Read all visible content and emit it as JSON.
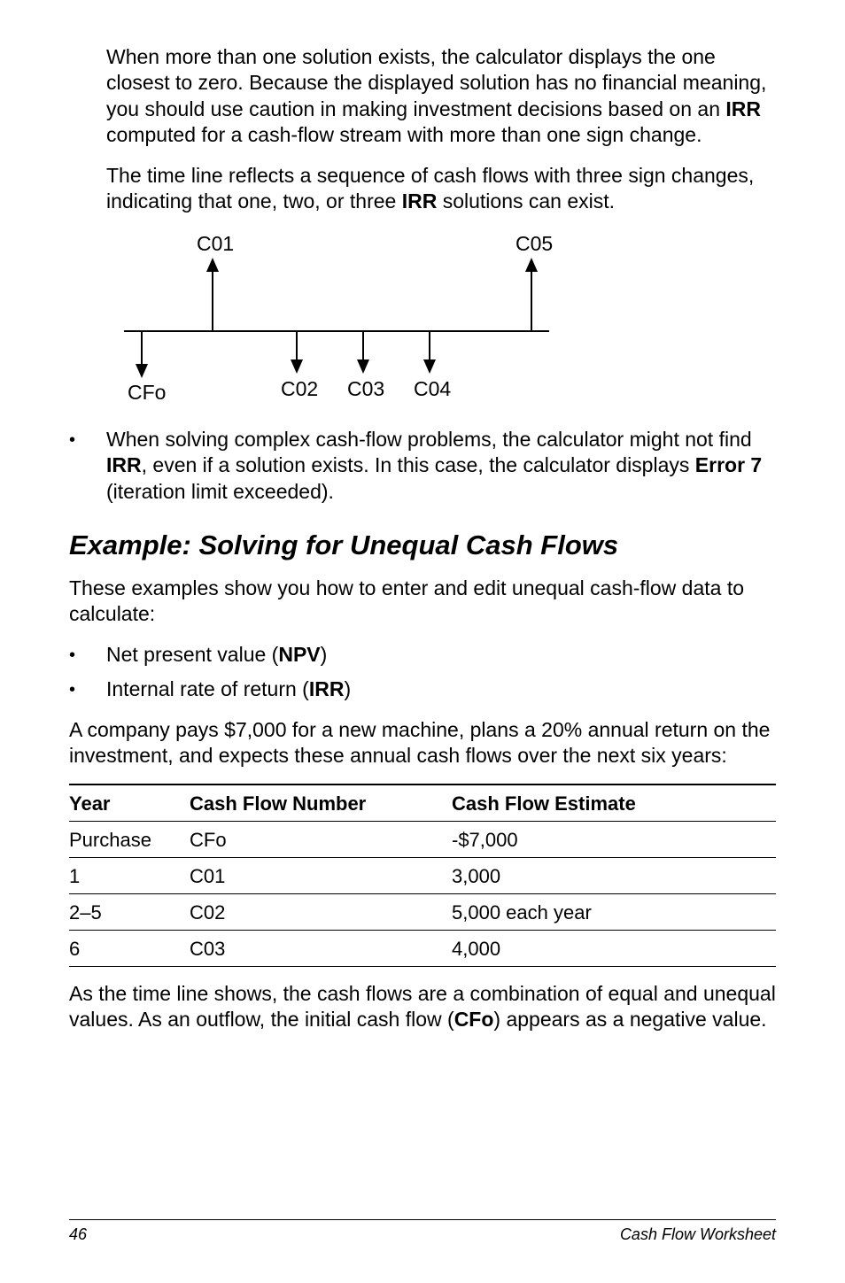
{
  "para1": {
    "pre": "When more than one solution exists, the calculator displays the one closest to zero. Because the displayed solution has no financial meaning, you should use caution in making investment decisions based on an ",
    "irr": "IRR",
    "post": " computed for a cash-flow stream with more than one sign change."
  },
  "para2": {
    "pre": "The time line reflects a sequence of cash flows with three sign changes, indicating that one, two, or three ",
    "irr": "IRR",
    "post": " solutions can exist."
  },
  "diagram": {
    "cfo": "CFo",
    "c01": "C01",
    "c02": "C02",
    "c03": "C03",
    "c04": "C04",
    "c05": "C05"
  },
  "bullet_complex": {
    "pre": "When solving complex cash-flow problems, the calculator might not find ",
    "irr": "IRR",
    "mid": ", even if a solution exists. In this case, the calculator displays ",
    "error7": "Error 7",
    "post": " (iteration limit exceeded)."
  },
  "heading": "Example: Solving for Unequal Cash Flows",
  "intro": "These examples show you how to enter and edit unequal cash-flow data to calculate:",
  "bullets": {
    "npv_pre": "Net present value (",
    "npv_bold": "NPV",
    "npv_post": ")",
    "irr_pre": "Internal rate of return (",
    "irr_bold": "IRR",
    "irr_post": ")"
  },
  "company_para": "A company pays $7,000 for a new machine, plans a 20% annual return on the investment, and expects these annual cash flows over the next six years:",
  "table": {
    "headers": {
      "year": "Year",
      "cfn": "Cash Flow Number",
      "cfe": "Cash Flow Estimate"
    },
    "rows": [
      {
        "year": "Purchase",
        "cfn": "CFo",
        "cfe": "-$7,000"
      },
      {
        "year": "1",
        "cfn": "C01",
        "cfe": "3,000"
      },
      {
        "year": "2–5",
        "cfn": "C02",
        "cfe": "5,000 each year"
      },
      {
        "year": "6",
        "cfn": "C03",
        "cfe": "4,000"
      }
    ]
  },
  "closing": {
    "pre": "As the time line shows, the cash flows are a combination of equal and unequal values. As an outflow, the initial cash flow (",
    "cfo": "CFo",
    "post": ") appears as a negative value."
  },
  "footer": {
    "page": "46",
    "title": "Cash Flow Worksheet"
  }
}
